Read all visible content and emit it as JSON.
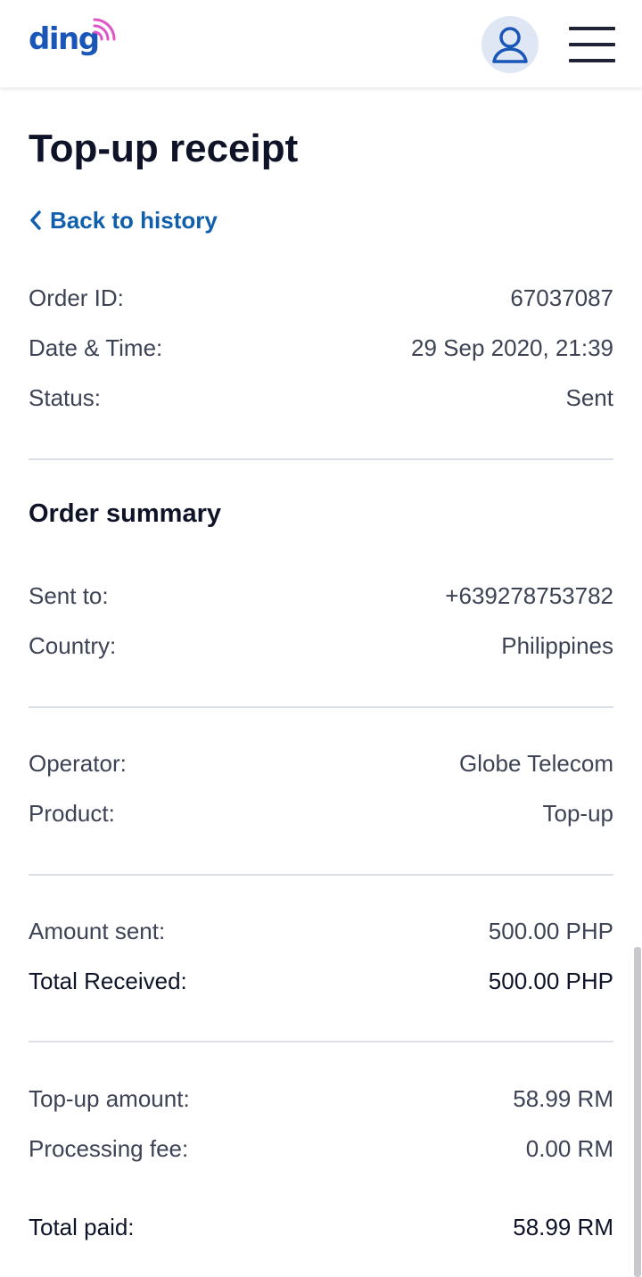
{
  "header": {
    "logo_text": "ding",
    "brand_color": "#1a56b8",
    "accent_color": "#e055c6",
    "account_icon": "user-icon",
    "menu_icon": "hamburger-menu-icon"
  },
  "page": {
    "title": "Top-up receipt",
    "back_label": "Back to history",
    "back_icon": "chevron-left-icon"
  },
  "order_info": {
    "order_id": {
      "label": "Order ID:",
      "value": "67037087"
    },
    "date_time": {
      "label": "Date & Time:",
      "value": "29 Sep 2020, 21:39"
    },
    "status": {
      "label": "Status:",
      "value": "Sent"
    }
  },
  "summary": {
    "title": "Order summary",
    "sent_to": {
      "label": "Sent to:",
      "value": "+639278753782"
    },
    "country": {
      "label": "Country:",
      "value": "Philippines"
    },
    "operator": {
      "label": "Operator:",
      "value": "Globe Telecom"
    },
    "product": {
      "label": "Product:",
      "value": "Top-up"
    },
    "amount_sent": {
      "label": "Amount sent:",
      "value": "500.00 PHP"
    },
    "total_received": {
      "label": "Total Received:",
      "value": "500.00 PHP"
    },
    "topup_amount": {
      "label": "Top-up amount:",
      "value": "58.99 RM"
    },
    "processing_fee": {
      "label": "Processing fee:",
      "value": "0.00 RM"
    },
    "total_paid": {
      "label": "Total paid:",
      "value": "58.99 RM"
    }
  }
}
